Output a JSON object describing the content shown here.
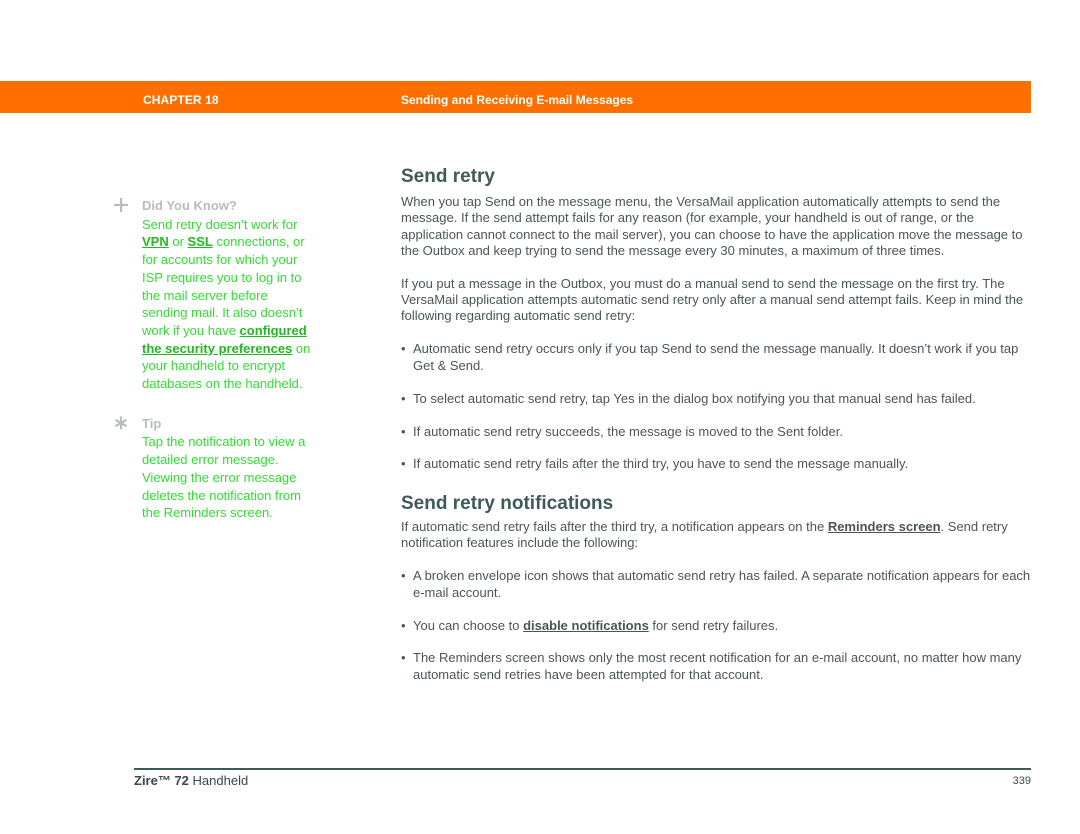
{
  "header": {
    "chapter": "CHAPTER 18",
    "title": "Sending and Receiving E-mail Messages",
    "bar_color": "#ff6f00"
  },
  "sidebar": {
    "did_you_know": {
      "icon": "plus-icon",
      "heading": "Did You Know?",
      "text_1": "Send retry doesn’t work for ",
      "link_vpn": "VPN",
      "text_2": " or ",
      "link_ssl": "SSL",
      "text_3": " connections, or for accounts for which your ISP requires you to log in to the mail server before sending mail. It also doesn’t work if you have ",
      "link_security": "configured the security preferences",
      "text_4": " on your handheld to encrypt databases on the handheld."
    },
    "tip": {
      "icon": "asterisk-icon",
      "heading": "Tip",
      "text": "Tap the notification to view a detailed error message. Viewing the error message deletes the notification from the Reminders screen."
    },
    "text_color": "#32dc32"
  },
  "main": {
    "send_retry": {
      "heading": "Send retry",
      "para1": "When you tap Send on the message menu, the VersaMail application automatically attempts to send the message. If the send attempt fails for any reason (for example, your handheld is out of range, or the application cannot connect to the mail server), you can choose to have the application move the message to the Outbox and keep trying to send the message every 30 minutes, a maximum of three times.",
      "para2": "If you put a message in the Outbox, you must do a manual send to send the message on the first try. The VersaMail application attempts automatic send retry only after a manual send attempt fails. Keep in mind the following regarding automatic send retry:",
      "bullets": [
        "Automatic send retry occurs only if you tap Send to send the message manually. It doesn’t work if you tap Get & Send.",
        "To select automatic send retry, tap Yes in the dialog box notifying you that manual send has failed.",
        "If automatic send retry succeeds, the message is moved to the Sent folder.",
        "If automatic send retry fails after the third try, you have to send the message manually."
      ]
    },
    "notifications": {
      "heading": "Send retry notifications",
      "intro_1": "If automatic send retry fails after the third try, a notification appears on the ",
      "intro_link": "Reminders screen",
      "intro_2": ". Send retry notification features include the following:",
      "bullet1": "A broken envelope icon shows that automatic send retry has failed. A separate notification appears for each e-mail account.",
      "bullet2_pre": "You can choose to ",
      "bullet2_link": "disable notifications",
      "bullet2_post": " for send retry failures.",
      "bullet3": "The Reminders screen shows only the most recent notification for an e-mail account, no matter how many automatic send retries have been attempted for that account."
    },
    "bullet_glyph": "•"
  },
  "footer": {
    "product_bold": "Zire™ 72",
    "product_rest": " Handheld",
    "page_number": "339"
  }
}
